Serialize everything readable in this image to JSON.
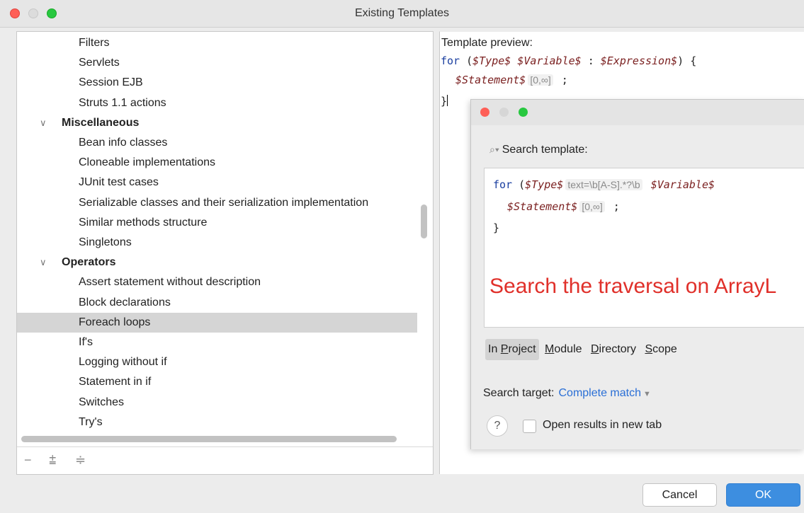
{
  "window": {
    "title": "Existing Templates"
  },
  "tree": {
    "rows": [
      {
        "label": "Filters",
        "type": "item"
      },
      {
        "label": "Servlets",
        "type": "item"
      },
      {
        "label": "Session EJB",
        "type": "item"
      },
      {
        "label": "Struts 1.1 actions",
        "type": "item"
      },
      {
        "label": "Miscellaneous",
        "type": "category"
      },
      {
        "label": "Bean info classes",
        "type": "item"
      },
      {
        "label": "Cloneable implementations",
        "type": "item"
      },
      {
        "label": "JUnit test cases",
        "type": "item"
      },
      {
        "label": "Serializable classes and their serialization implementation",
        "type": "item"
      },
      {
        "label": "Similar methods structure",
        "type": "item"
      },
      {
        "label": "Singletons",
        "type": "item"
      },
      {
        "label": "Operators",
        "type": "category"
      },
      {
        "label": "Assert statement without description",
        "type": "item"
      },
      {
        "label": "Block declarations",
        "type": "item"
      },
      {
        "label": "Foreach loops",
        "type": "item",
        "selected": true
      },
      {
        "label": "If's",
        "type": "item"
      },
      {
        "label": "Logging without if",
        "type": "item"
      },
      {
        "label": "Statement in if",
        "type": "item"
      },
      {
        "label": "Switches",
        "type": "item"
      },
      {
        "label": "Try's",
        "type": "item"
      }
    ],
    "toolbar_icons": [
      "collapse-minus-icon",
      "expand-all-icon",
      "collapse-all-icon"
    ]
  },
  "preview": {
    "label": "Template preview:",
    "line1": {
      "kw": "for",
      "open": " (",
      "type": "$Type$",
      "var": "$Variable$",
      "colon": " : ",
      "expr": "$Expression$",
      "close": ") {"
    },
    "line2": {
      "stmt": "$Statement$",
      "count": "[0,∞]",
      "semi": " ;"
    },
    "line3": "}"
  },
  "dialog": {
    "search_label": "Search template:",
    "code": {
      "kw": "for",
      "open": " (",
      "type": "$Type$",
      "type_constraint": "text=\\b[A-S].*?\\b",
      "var": "$Variable$",
      "stmt": "$Statement$",
      "count": "[0,∞]",
      "semi": " ;",
      "close": "}"
    },
    "annotation": "Search the traversal on ArrayL",
    "scopes": [
      {
        "label": "In Project",
        "active": true
      },
      {
        "label": "Module"
      },
      {
        "label": "Directory"
      },
      {
        "label": "Scope"
      }
    ],
    "target_label": "Search target:",
    "target_value": "Complete match",
    "help": "?",
    "checkbox_label": "Open results in new tab",
    "checkbox_checked": false
  },
  "buttons": {
    "cancel": "Cancel",
    "ok": "OK"
  },
  "colors": {
    "accent": "#3d8ee0",
    "annotation": "#e0302a",
    "keyword": "#1b3fa0",
    "variable": "#7a1f1f"
  }
}
